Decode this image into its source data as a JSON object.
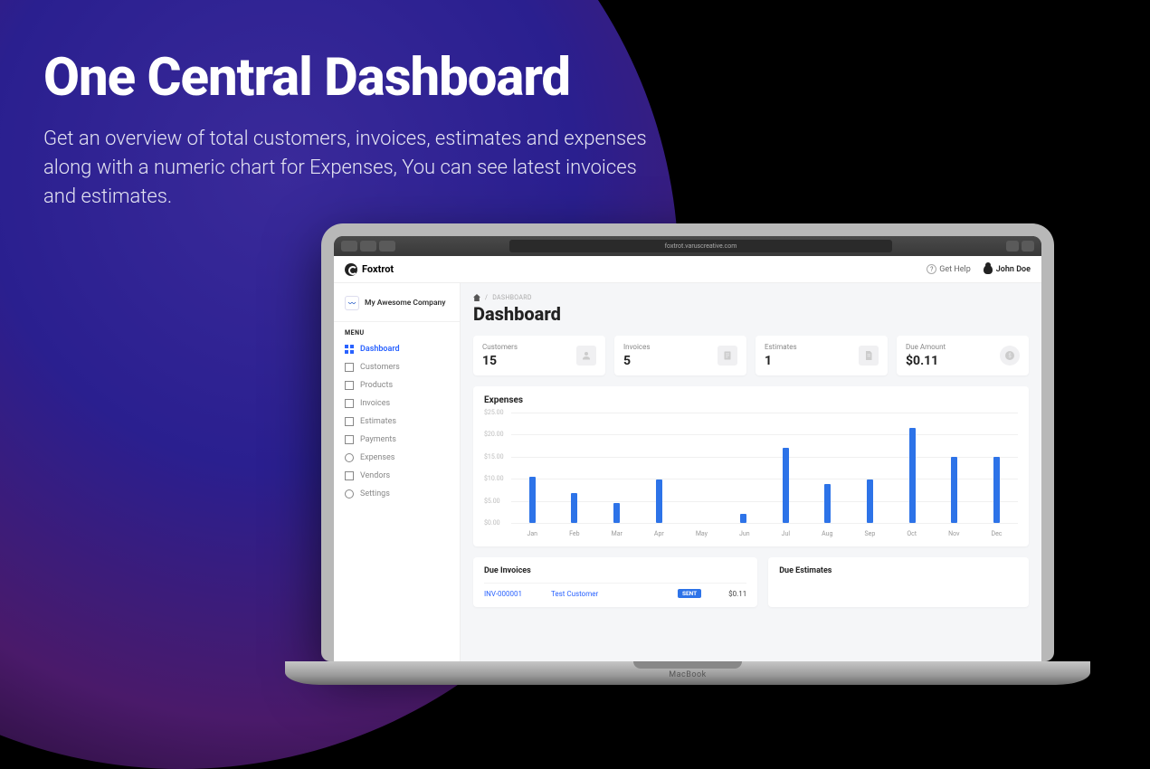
{
  "hero": {
    "title": "One Central Dashboard",
    "subtitle": "Get an overview of total customers, invoices, estimates and expenses along with a numeric chart for Expenses, You can see latest invoices\nand estimates."
  },
  "browser": {
    "address": "foxtrot.varuscreative.com"
  },
  "app": {
    "brand": "Foxtrot",
    "help_label": "Get Help",
    "user_name": "John Doe"
  },
  "sidebar": {
    "company": "My Awesome Company",
    "menu_label": "MENU",
    "items": [
      {
        "label": "Dashboard",
        "active": true
      },
      {
        "label": "Customers"
      },
      {
        "label": "Products"
      },
      {
        "label": "Invoices"
      },
      {
        "label": "Estimates"
      },
      {
        "label": "Payments"
      },
      {
        "label": "Expenses"
      },
      {
        "label": "Vendors"
      },
      {
        "label": "Settings"
      }
    ]
  },
  "page": {
    "breadcrumb": "DASHBOARD",
    "title": "Dashboard"
  },
  "stats": [
    {
      "label": "Customers",
      "value": "15"
    },
    {
      "label": "Invoices",
      "value": "5"
    },
    {
      "label": "Estimates",
      "value": "1"
    },
    {
      "label": "Due Amount",
      "value": "$0.11"
    }
  ],
  "chart_data": {
    "type": "bar",
    "title": "Expenses",
    "ylabel": "",
    "xlabel": "",
    "ylim": [
      0,
      25
    ],
    "yticks": [
      "$25.00",
      "$20.00",
      "$15.00",
      "$10.00",
      "$5.00",
      "$0.00"
    ],
    "categories": [
      "Jan",
      "Feb",
      "Mar",
      "Apr",
      "May",
      "Jun",
      "Jul",
      "Aug",
      "Sep",
      "Oct",
      "Nov",
      "Dec"
    ],
    "values": [
      10.5,
      6.8,
      4.5,
      9.8,
      0,
      2,
      17,
      8.8,
      9.8,
      21.5,
      15,
      15
    ]
  },
  "due_invoices": {
    "title": "Due Invoices",
    "rows": [
      {
        "id": "INV-000001",
        "customer": "Test Customer",
        "status": "SENT",
        "amount": "$0.11"
      }
    ]
  },
  "due_estimates": {
    "title": "Due Estimates"
  },
  "device_brand": "MacBook"
}
